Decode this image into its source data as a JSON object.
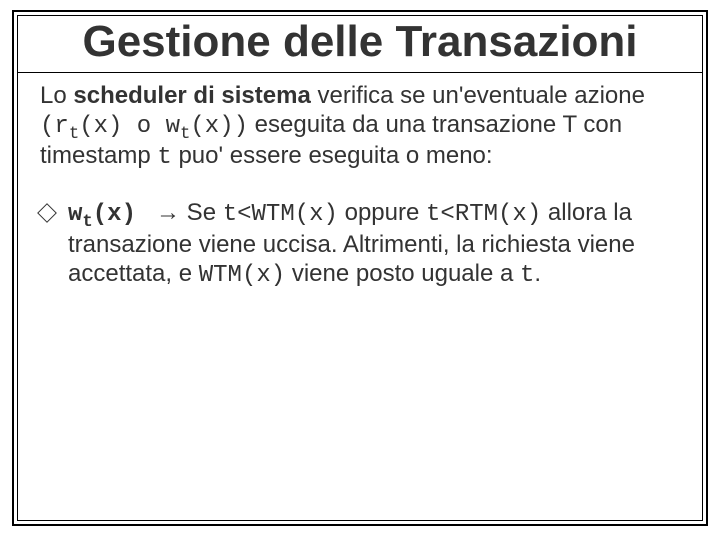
{
  "title": "Gestione delle Transazioni",
  "para1": {
    "t1": "Lo ",
    "bold": "scheduler di sistema",
    "t2": " verifica se un'eventuale azione ",
    "code_open": "(r",
    "code_sub1": "t",
    "code_mid1": "(x) o w",
    "code_sub2": "t",
    "code_mid2": "(x))",
    "t3": " eseguita da una transazione T con timestamp ",
    "code_t": "t",
    "t4": " puo' essere eseguita o meno:"
  },
  "bullet": {
    "lead_w": "w",
    "lead_sub": "t",
    "lead_tail": "(x)",
    "arrow": "→",
    "se": "  Se ",
    "cond1a": "t<WTM(x)",
    "opp": " oppure ",
    "cond2a": "t<RTM(x)",
    "rest1": " allora la transazione viene uccisa. Altrimenti, la richiesta viene accettata, e ",
    "wtm": "WTM(x)",
    "rest2": " viene posto uguale a ",
    "tfinal": "t",
    "period": "."
  }
}
